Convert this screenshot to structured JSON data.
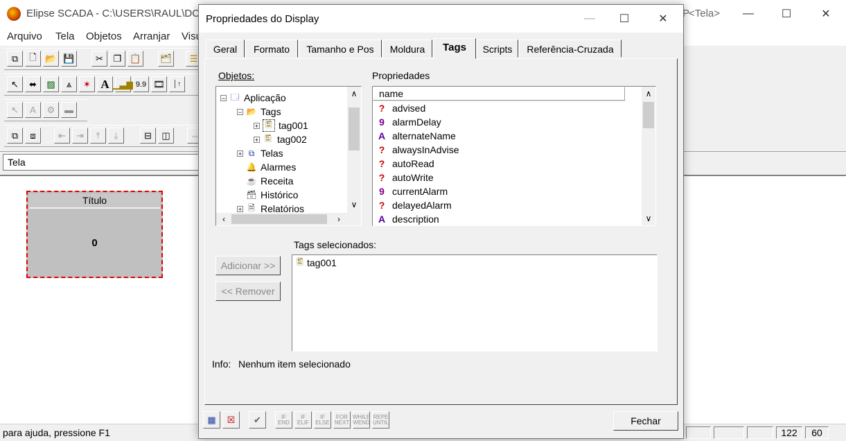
{
  "main_window": {
    "title": "Elipse SCADA - C:\\USERS\\RAUL\\DOCU",
    "title_right": "<Tela>",
    "title_right_prefix": "P",
    "menu": [
      "Arquivo",
      "Tela",
      "Objetos",
      "Arranjar",
      "Visu"
    ],
    "screen_combo": "Tela",
    "display_object": {
      "title": "Título",
      "value": "0"
    },
    "status": {
      "message": "para ajuda, pressione F1",
      "cell1": "122",
      "cell2": "60"
    },
    "toolbar_value": "9.9"
  },
  "dialog": {
    "title": "Propriedades do Display",
    "tabs": [
      "Geral",
      "Formato",
      "Tamanho e Pos",
      "Moldura",
      "Tags",
      "Scripts",
      "Referência-Cruzada"
    ],
    "selected_tab": "Tags",
    "objects_label": "Objetos:",
    "properties_label": "Propriedades",
    "tree": [
      {
        "label": "Aplicação",
        "expander": "−"
      },
      {
        "label": "Tags",
        "expander": "−"
      },
      {
        "label": "tag001",
        "expander": "+"
      },
      {
        "label": "tag002",
        "expander": "+"
      },
      {
        "label": "Telas",
        "expander": "+"
      },
      {
        "label": "Alarmes",
        "expander": ""
      },
      {
        "label": "Receita",
        "expander": ""
      },
      {
        "label": "Histórico",
        "expander": ""
      },
      {
        "label": "Relatórios",
        "expander": "+"
      }
    ],
    "props_header": "name",
    "properties": [
      {
        "icon": "?",
        "name": "advised"
      },
      {
        "icon": "9",
        "name": "alarmDelay"
      },
      {
        "icon": "A",
        "name": "alternateName"
      },
      {
        "icon": "?",
        "name": "alwaysInAdvise"
      },
      {
        "icon": "?",
        "name": "autoRead"
      },
      {
        "icon": "?",
        "name": "autoWrite"
      },
      {
        "icon": "9",
        "name": "currentAlarm"
      },
      {
        "icon": "?",
        "name": "delayedAlarm"
      },
      {
        "icon": "A",
        "name": "description"
      }
    ],
    "add_button": "Adicionar >>",
    "remove_button": "<< Remover",
    "selected_tags_label": "Tags selecionados:",
    "selected_tags": [
      "tag001"
    ],
    "info_label": "Info:",
    "info_text": "Nenhum item selecionado",
    "close_button": "Fechar",
    "script_buttons": [
      "IF END",
      "IF ELIF",
      "IF ELSE",
      "FOR NEXT",
      "WHILE WEND",
      "REPE UNTIL"
    ],
    "colors": {
      "bool_icon": "#cc0000",
      "num_icon": "#7a0090",
      "text_icon": "#5a00a0"
    }
  }
}
